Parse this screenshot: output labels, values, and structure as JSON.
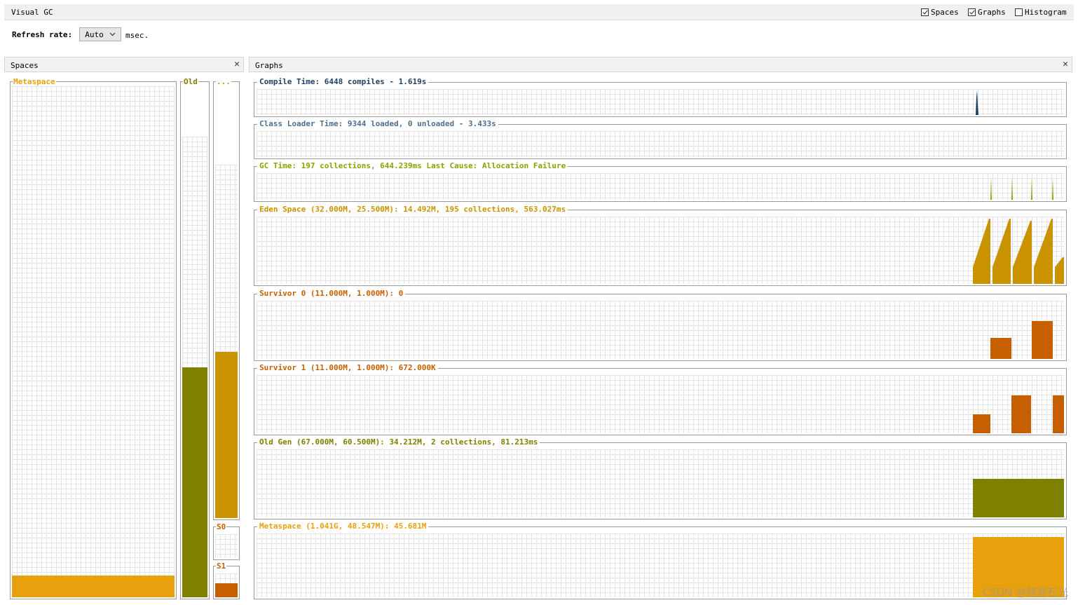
{
  "window": {
    "title": "Visual GC"
  },
  "options": {
    "spaces": {
      "label": "Spaces",
      "checked": true
    },
    "graphs": {
      "label": "Graphs",
      "checked": true
    },
    "histogram": {
      "label": "Histogram",
      "checked": false
    }
  },
  "refresh": {
    "label": "Refresh rate:",
    "value": "Auto",
    "unit": "msec."
  },
  "spaces_panel": {
    "title": "Spaces",
    "close": "✕",
    "metaspace": {
      "label": "Metaspace",
      "color": "#e8a00c",
      "level": 0.043
    },
    "old": {
      "label": "Old",
      "color": "#7f7f00",
      "level": 0.5
    },
    "eden": {
      "label": "...",
      "color": "#c99300",
      "level": 0.47
    },
    "s0": {
      "label": "S0",
      "color": "#c65f00",
      "level": 0.0
    },
    "s1": {
      "label": "S1",
      "color": "#c65f00",
      "level": 0.58
    }
  },
  "graphs_panel": {
    "title": "Graphs",
    "close": "✕",
    "compile_time": {
      "label": "Compile Time: 6448 compiles - 1.619s",
      "color": "#1f3f5f"
    },
    "class_loader": {
      "label": "Class Loader Time: 9344 loaded, 0 unloaded - 3.433s",
      "color": "#4f6f8f"
    },
    "gc_time": {
      "label": "GC Time: 197 collections, 644.239ms Last Cause: Allocation Failure",
      "color": "#8fa000"
    },
    "eden": {
      "label": "Eden Space (32.000M, 25.500M): 14.492M, 195 collections, 563.027ms",
      "color": "#c99300"
    },
    "survivor0": {
      "label": "Survivor 0 (11.000M, 1.000M): 0",
      "color": "#c65f00"
    },
    "survivor1": {
      "label": "Survivor 1 (11.000M, 1.000M): 672.000K",
      "color": "#c65f00"
    },
    "old_gen": {
      "label": "Old Gen (67.000M, 60.500M): 34.212M, 2 collections, 81.213ms",
      "color": "#7f7f00"
    },
    "metaspace": {
      "label": "Metaspace (1.041G, 48.547M): 45.681M",
      "color": "#e8a00c"
    }
  },
  "watermark": "CSDN @随意石光"
}
